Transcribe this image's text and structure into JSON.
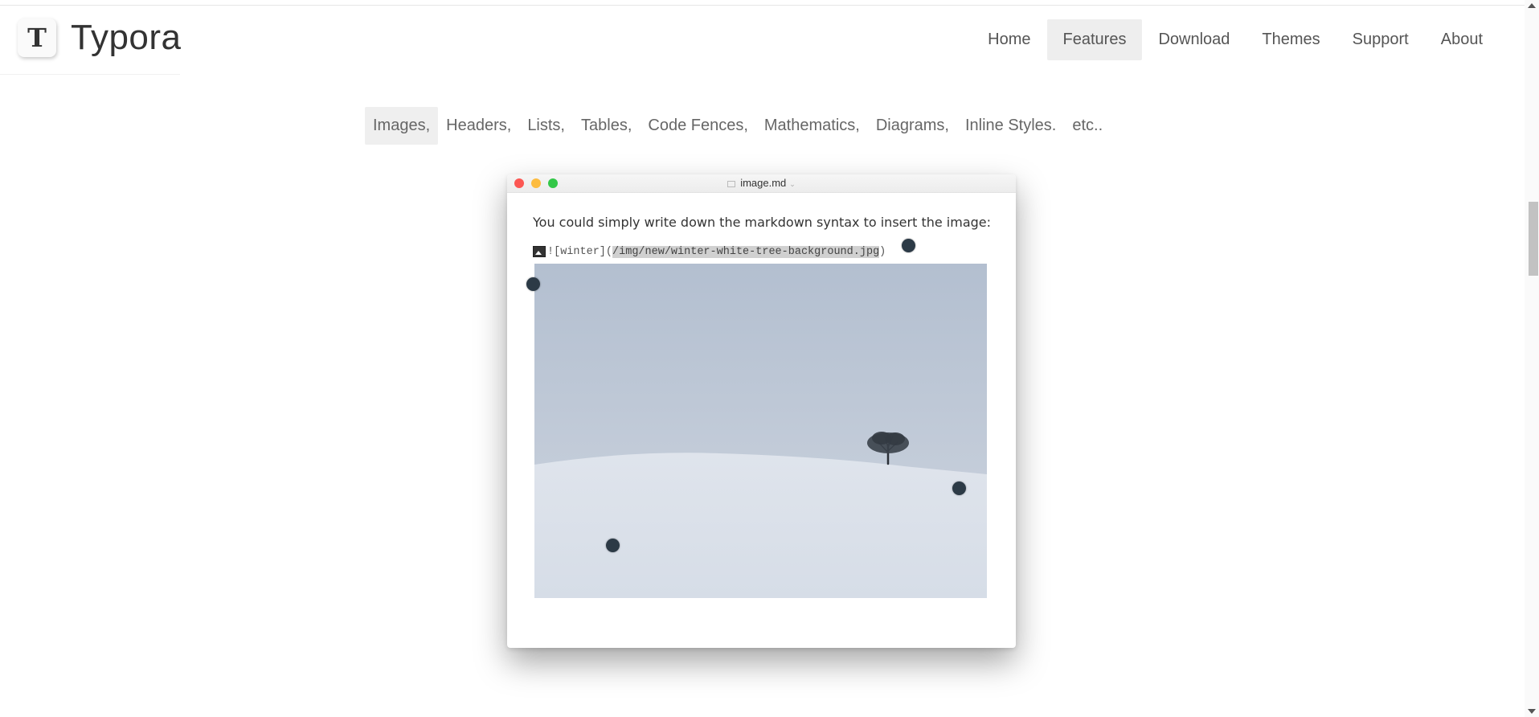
{
  "logo": {
    "letter": "T",
    "name": "Typora"
  },
  "nav": {
    "items": [
      {
        "label": "Home"
      },
      {
        "label": "Features",
        "active": true
      },
      {
        "label": "Download"
      },
      {
        "label": "Themes"
      },
      {
        "label": "Support"
      },
      {
        "label": "About"
      }
    ]
  },
  "features": {
    "items": [
      {
        "label": "Images,",
        "active": true
      },
      {
        "label": "Headers,"
      },
      {
        "label": "Lists,"
      },
      {
        "label": "Tables,"
      },
      {
        "label": "Code Fences,"
      },
      {
        "label": "Mathematics,"
      },
      {
        "label": "Diagrams,"
      },
      {
        "label": "Inline Styles."
      },
      {
        "label": "etc.."
      }
    ]
  },
  "window": {
    "title": "image.md",
    "description": "You could simply write down the markdown syntax to insert the image:",
    "markdown_prefix": "![winter](",
    "markdown_path": "/img/new/winter-white-tree-background.jpg",
    "markdown_suffix": ")"
  },
  "colors": {
    "traffic_red": "#fc5753",
    "traffic_yellow": "#fdbc40",
    "traffic_green": "#33c748",
    "active_bg": "#eeeeee",
    "touch_dot": "#2c3a46"
  }
}
